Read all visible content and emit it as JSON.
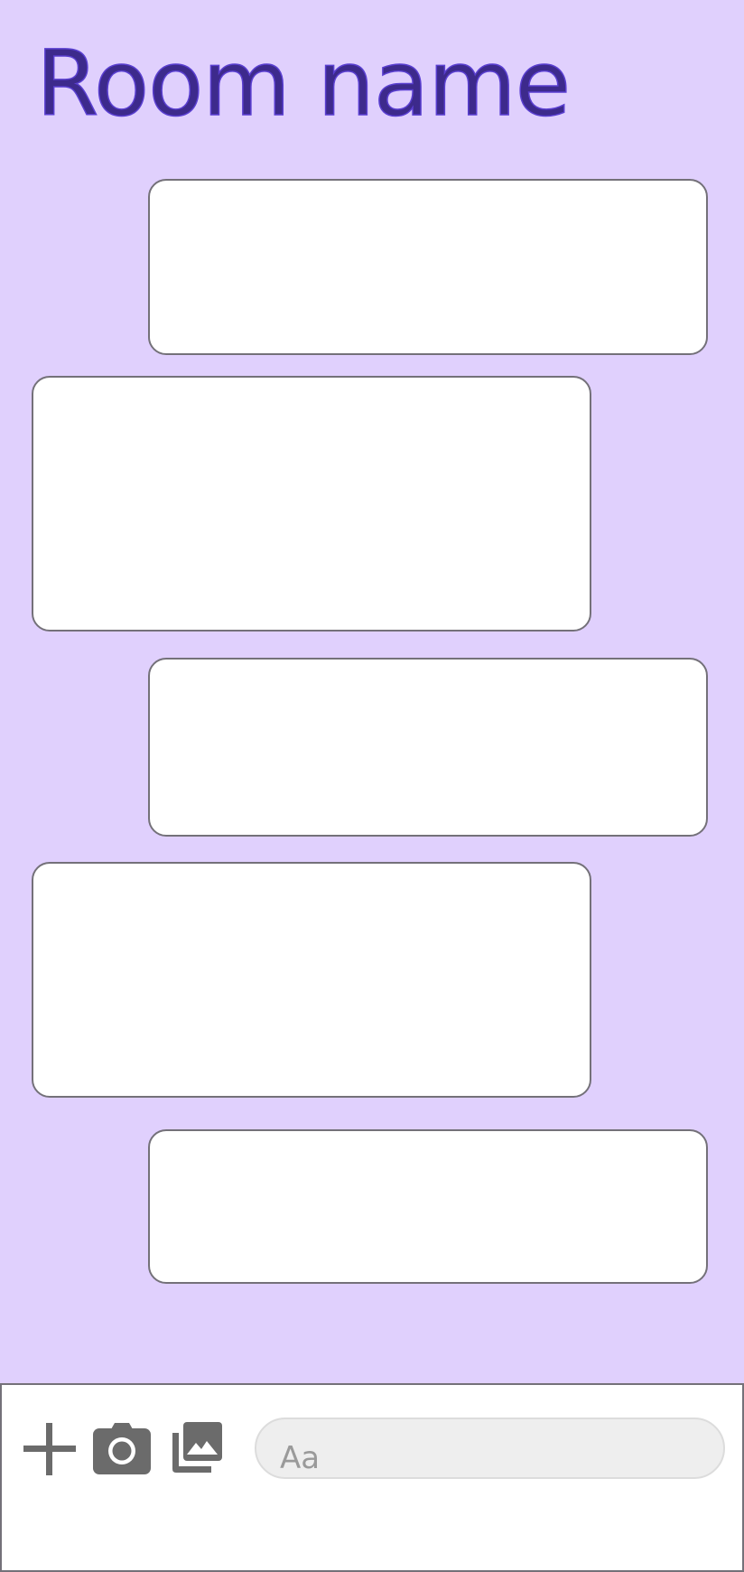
{
  "header": {
    "title": "Room name"
  },
  "messages": [
    {
      "direction": "sent",
      "text": ""
    },
    {
      "direction": "received",
      "text": ""
    },
    {
      "direction": "sent",
      "text": ""
    },
    {
      "direction": "received",
      "text": ""
    },
    {
      "direction": "sent",
      "text": ""
    }
  ],
  "composer": {
    "icons": [
      "plus-icon",
      "camera-icon",
      "gallery-icon"
    ],
    "input_placeholder": "Aa",
    "input_value": ""
  },
  "colors": {
    "chat_background": "#e0d0fd",
    "title": "#3d2a8c",
    "bubble_background": "#ffffff",
    "bubble_border": "#747179",
    "icon": "#6b6b6b",
    "input_background": "#eeeeee"
  }
}
